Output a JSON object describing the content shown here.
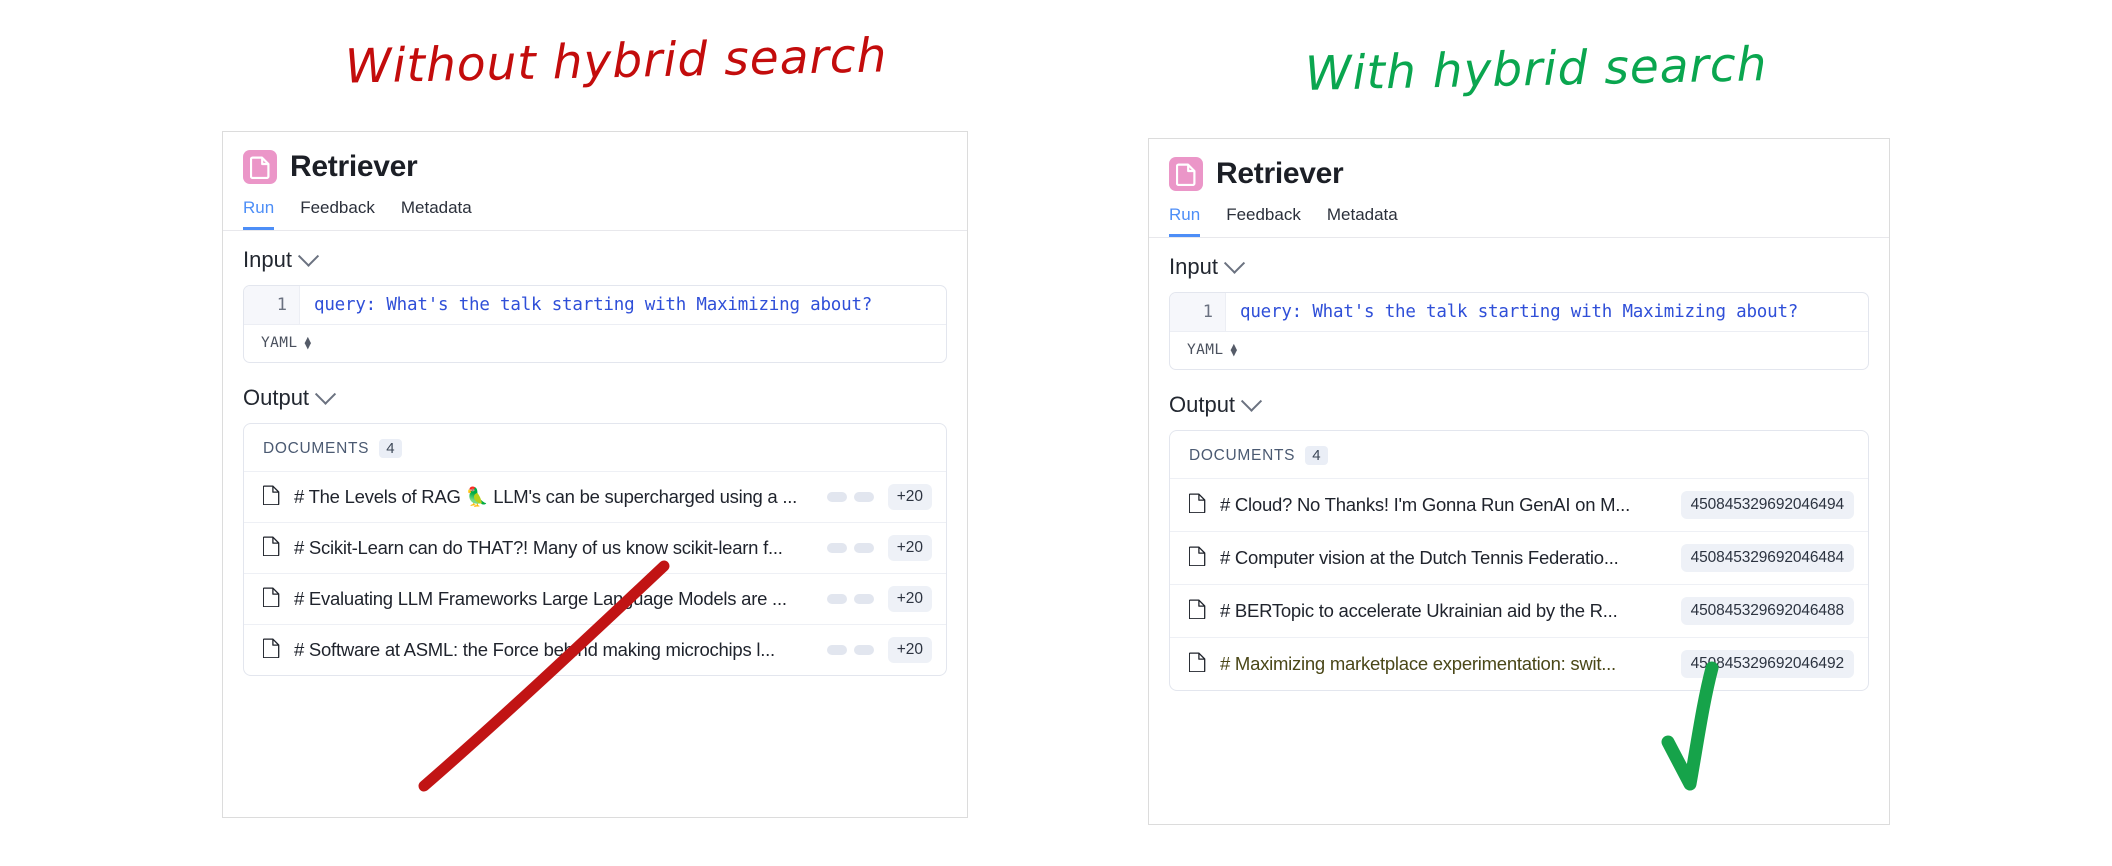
{
  "annotations": {
    "left_title": "Without hybrid search",
    "right_title": "With hybrid search",
    "left_title_color": "#c30c0c",
    "right_title_color": "#0aa64f",
    "strike_color": "#c11414",
    "check_color": "#16a34a",
    "highlight_color": "#f7ee4e"
  },
  "panels": [
    {
      "id": "without-hybrid-search",
      "header": {
        "icon": "document-icon",
        "icon_color": "#eb96c8",
        "title": "Retriever",
        "tabs": [
          {
            "label": "Run",
            "active": true
          },
          {
            "label": "Feedback",
            "active": false
          },
          {
            "label": "Metadata",
            "active": false
          }
        ]
      },
      "input": {
        "section_label": "Input",
        "line_number": "1",
        "code_prefix": "query: What's the talk starting with Maximizing about?",
        "highlight_term": "",
        "code_suffix": "",
        "format": "YAML"
      },
      "output": {
        "section_label": "Output",
        "documents_label": "DOCUMENTS",
        "documents_count": "4",
        "rows": [
          {
            "text": "# The Levels of RAG 🦜 LLM's can be supercharged using a ...",
            "badge": "+20",
            "dots": true,
            "highlighted": false
          },
          {
            "text": "# Scikit-Learn can do THAT?! Many of us know scikit-learn f...",
            "badge": "+20",
            "dots": true,
            "highlighted": false
          },
          {
            "text": "# Evaluating LLM Frameworks Large Language Models are ...",
            "badge": "+20",
            "dots": true,
            "highlighted": false
          },
          {
            "text": "# Software at ASML: the Force behind making microchips l...",
            "badge": "+20",
            "dots": true,
            "highlighted": false
          }
        ]
      }
    },
    {
      "id": "with-hybrid-search",
      "header": {
        "icon": "document-icon",
        "icon_color": "#eb96c8",
        "title": "Retriever",
        "tabs": [
          {
            "label": "Run",
            "active": true
          },
          {
            "label": "Feedback",
            "active": false
          },
          {
            "label": "Metadata",
            "active": false
          }
        ]
      },
      "input": {
        "section_label": "Input",
        "line_number": "1",
        "code_prefix": "query: What's the talk starting with ",
        "highlight_term": "Maximizing",
        "code_suffix": " about?",
        "format": "YAML"
      },
      "output": {
        "section_label": "Output",
        "documents_label": "DOCUMENTS",
        "documents_count": "4",
        "rows": [
          {
            "text": "# Cloud? No Thanks! I'm Gonna Run GenAI on M...",
            "badge": "450845329692046494",
            "dots": false,
            "highlighted": false
          },
          {
            "text": "# Computer vision at the Dutch Tennis Federatio...",
            "badge": "450845329692046484",
            "dots": false,
            "highlighted": false
          },
          {
            "text": "# BERTopic to accelerate Ukrainian aid by the R...",
            "badge": "450845329692046488",
            "dots": false,
            "highlighted": false
          },
          {
            "text": "# Maximizing marketplace experimentation: swit...",
            "badge": "450845329692046492",
            "dots": false,
            "highlighted": true
          }
        ]
      }
    }
  ]
}
